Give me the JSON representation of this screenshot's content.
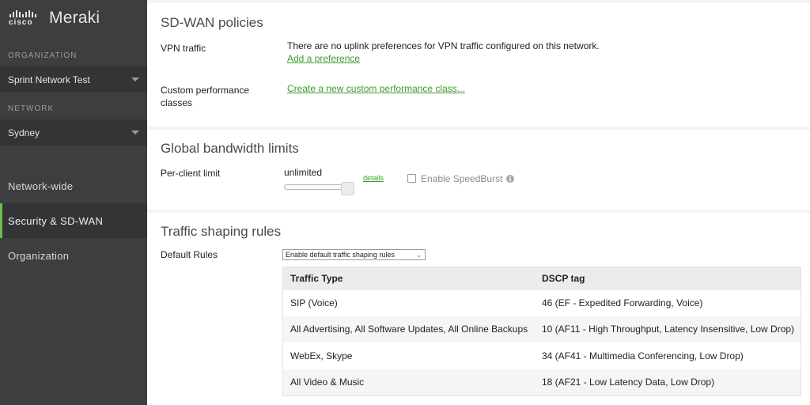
{
  "brand": {
    "company": "cisco",
    "product": "Meraki"
  },
  "sidebar": {
    "organization_label": "ORGANIZATION",
    "organization_value": "Sprint Network Test",
    "network_label": "NETWORK",
    "network_value": "Sydney",
    "nav": [
      {
        "label": "Network-wide",
        "active": false
      },
      {
        "label": "Security & SD-WAN",
        "active": true
      },
      {
        "label": "Organization",
        "active": false
      }
    ],
    "accent_color": "#6cc04a"
  },
  "sdwan": {
    "title": "SD-WAN policies",
    "vpn_label": "VPN traffic",
    "vpn_text": "There are no uplink preferences for VPN traffic configured on this network.",
    "add_pref_link": "Add a preference",
    "custom_label_line1": "Custom performance",
    "custom_label_line2": "classes",
    "create_class_link": "Create a new custom performance class..."
  },
  "bandwidth": {
    "title": "Global bandwidth limits",
    "per_client_label": "Per-client limit",
    "limit_value": "unlimited",
    "slider_position_pct": 100,
    "details_link": "details",
    "speedburst_label": "Enable SpeedBurst",
    "speedburst_checked": false,
    "info_icon": "i"
  },
  "shaping": {
    "title": "Traffic shaping rules",
    "default_rules_label": "Default Rules",
    "default_rules_selected": "Enable default traffic shaping rules",
    "table": {
      "headers": [
        "Traffic Type",
        "DSCP tag"
      ],
      "rows": [
        [
          "SIP (Voice)",
          "46 (EF - Expedited Forwarding, Voice)"
        ],
        [
          "All Advertising, All Software Updates, All Online Backups",
          "10 (AF11 - High Throughput, Latency Insensitive, Low Drop)"
        ],
        [
          "WebEx, Skype",
          "34 (AF41 - Multimedia Conferencing, Low Drop)"
        ],
        [
          "All Video & Music",
          "18 (AF21 - Low Latency Data, Low Drop)"
        ]
      ]
    }
  },
  "link_color": "#3b9a2b"
}
